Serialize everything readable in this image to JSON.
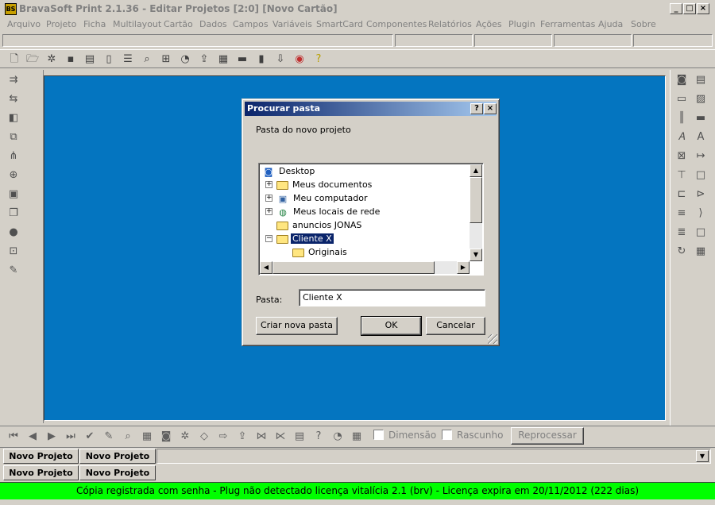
{
  "window": {
    "title": "BravaSoft Print 2.1.36 - Editar Projetos [2:0] [Novo Cartão]",
    "app_icon_text": "BS",
    "minimize": "_",
    "restore": "□",
    "close": "×"
  },
  "menu": [
    "Arquivo",
    "Projeto",
    "Ficha",
    "Multilayout",
    "Cartão",
    "Dados",
    "Campos",
    "Variáveis",
    "SmartCard",
    "Componentes",
    "Relatórios",
    "Ações",
    "Plugin",
    "Ferramentas",
    "Ajuda",
    "Sobre"
  ],
  "toolbar_icons": [
    "new-file-icon",
    "open-folder-icon",
    "gear-icon",
    "save-icon",
    "print-icon",
    "document-icon",
    "list-icon",
    "preview-icon",
    "tree-icon",
    "disk-icon",
    "export-icon",
    "grid-icon",
    "bar-icon",
    "cylinder-icon",
    "import-icon",
    "color-wheel-icon",
    "help-icon"
  ],
  "dialog": {
    "title": "Procurar pasta",
    "help_btn": "?",
    "close_btn": "×",
    "description": "Pasta do novo projeto",
    "tree": [
      {
        "label": "Desktop",
        "icon": "desktop-icon"
      },
      {
        "label": "Meus documentos",
        "icon": "documents-folder-icon",
        "expander": "+"
      },
      {
        "label": "Meu computador",
        "icon": "computer-icon",
        "expander": "+"
      },
      {
        "label": "Meus locais de rede",
        "icon": "network-icon",
        "expander": "+"
      },
      {
        "label": "anuncios JONAS",
        "icon": "folder-icon"
      },
      {
        "label": "Cliente X",
        "icon": "open-folder-icon",
        "expander": "−",
        "selected": true
      },
      {
        "label": "Originais",
        "icon": "folder-icon"
      }
    ],
    "folder_label": "Pasta:",
    "folder_value": "Cliente X",
    "new_folder_btn": "Criar nova pasta",
    "ok_btn": "OK",
    "cancel_btn": "Cancelar"
  },
  "bottom_toolbar": {
    "dimension_label": "Dimensão",
    "draft_label": "Rascunho",
    "reprocess_btn": "Reprocessar"
  },
  "tabs_row1": [
    "Novo Projeto",
    "Novo Projeto"
  ],
  "tabs_row2": [
    "Novo Projeto",
    "Novo Projeto"
  ],
  "status": "Cópia registrada com senha - Plug não detectado licença vitalícia 2.1 (brv) - Licença expira em 20/11/2012 (222 dias)",
  "colors": {
    "workspace": "#0475c0",
    "status_bg": "#00ff00",
    "selection": "#0a246a"
  }
}
